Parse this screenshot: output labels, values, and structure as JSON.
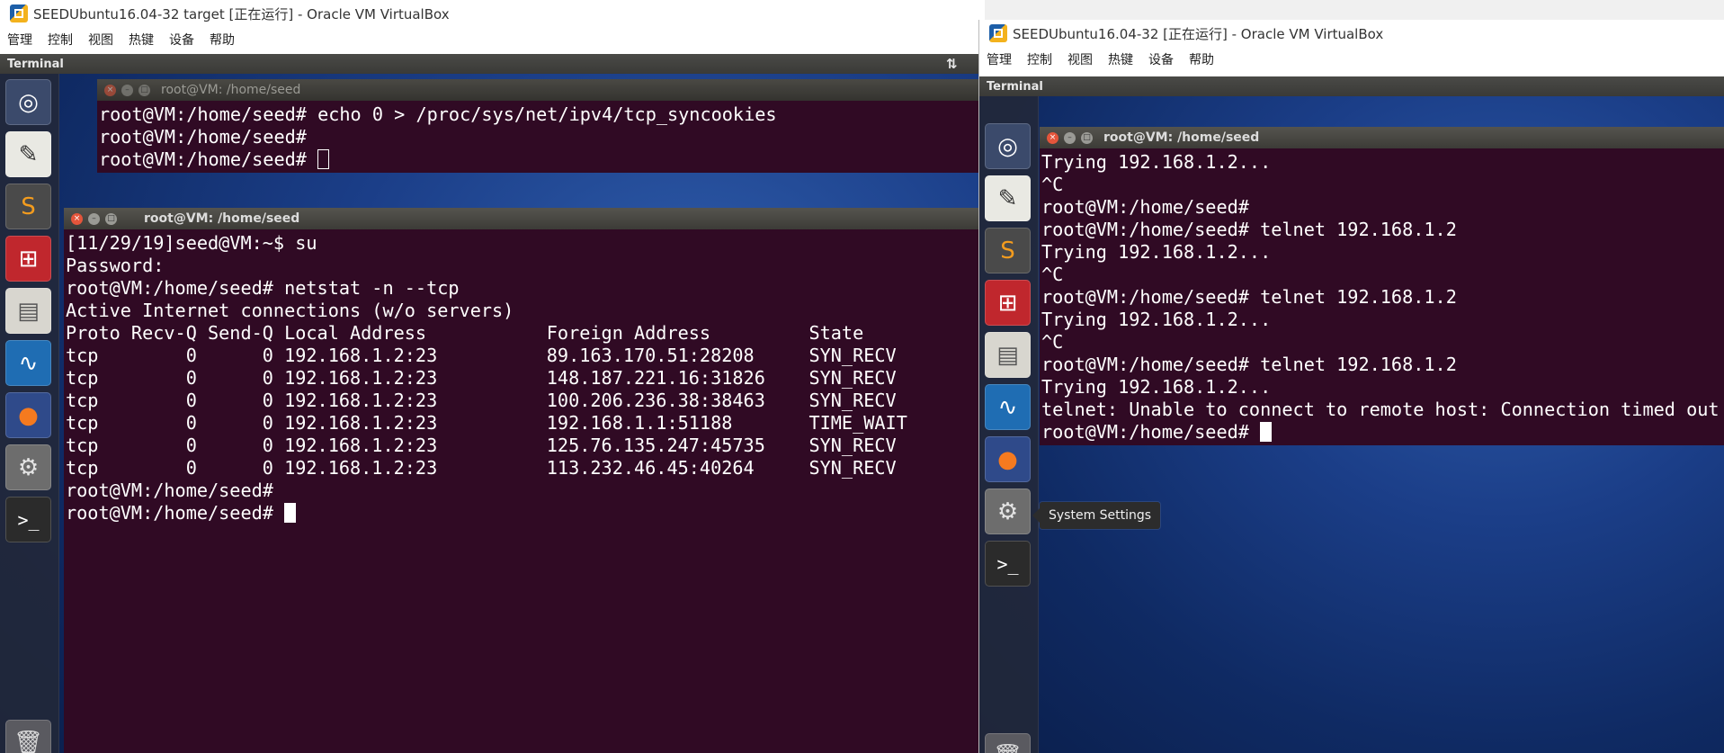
{
  "left_vm": {
    "title": "SEEDUbuntu16.04-32 target [正在运行] - Oracle VM VirtualBox",
    "menu": [
      "管理",
      "控制",
      "视图",
      "热键",
      "设备",
      "帮助"
    ],
    "window_controls": [
      "—",
      "☐",
      "✕"
    ],
    "unity_bar_title": "Terminal",
    "unity_bar_icon": "⇅",
    "terminal_top": {
      "title": "root@VM: /home/seed",
      "lines": [
        "root@VM:/home/seed# echo 0 > /proc/sys/net/ipv4/tcp_syncookies",
        "root@VM:/home/seed# ",
        "root@VM:/home/seed# "
      ]
    },
    "terminal_main": {
      "title": "root@VM: /home/seed",
      "lines": [
        "[11/29/19]seed@VM:~$ su",
        "Password:",
        "root@VM:/home/seed# netstat -n --tcp",
        "Active Internet connections (w/o servers)",
        "Proto Recv-Q Send-Q Local Address           Foreign Address         State",
        "tcp        0      0 192.168.1.2:23          89.163.170.51:28208     SYN_RECV",
        "tcp        0      0 192.168.1.2:23          148.187.221.16:31826    SYN_RECV",
        "tcp        0      0 192.168.1.2:23          100.206.236.38:38463    SYN_RECV",
        "tcp        0      0 192.168.1.2:23          192.168.1.1:51188       TIME_WAIT",
        "tcp        0      0 192.168.1.2:23          125.76.135.247:45735    SYN_RECV",
        "tcp        0      0 192.168.1.2:23          113.232.46.45:40264     SYN_RECV",
        "root@VM:/home/seed# ",
        "root@VM:/home/seed# "
      ]
    }
  },
  "right_vm": {
    "title": "SEEDUbuntu16.04-32 [正在运行] - Oracle VM VirtualBox",
    "menu": [
      "管理",
      "控制",
      "视图",
      "热键",
      "设备",
      "帮助"
    ],
    "unity_bar_title": "Terminal",
    "terminal": {
      "title": "root@VM: /home/seed",
      "lines": [
        "Trying 192.168.1.2...",
        "^C",
        "root@VM:/home/seed# ",
        "root@VM:/home/seed# telnet 192.168.1.2",
        "Trying 192.168.1.2...",
        "^C",
        "root@VM:/home/seed# telnet 192.168.1.2",
        "Trying 192.168.1.2...",
        "^C",
        "root@VM:/home/seed# telnet 192.168.1.2",
        "Trying 192.168.1.2...",
        "telnet: Unable to connect to remote host: Connection timed out",
        "root@VM:/home/seed# "
      ]
    },
    "tooltip": "System Settings"
  },
  "launcher_icons": [
    {
      "name": "ubuntu-dash-icon",
      "glyph": "◎",
      "bg": "#3b4a6b",
      "fg": "#ffffff"
    },
    {
      "name": "text-editor-icon",
      "glyph": "✎",
      "bg": "#e9e9e3",
      "fg": "#333333"
    },
    {
      "name": "sublime-text-icon",
      "glyph": "S",
      "bg": "#4a4a4a",
      "fg": "#f39c1e"
    },
    {
      "name": "network-tool-icon",
      "glyph": "⊞",
      "bg": "#c0272d",
      "fg": "#ffffff"
    },
    {
      "name": "file-manager-icon",
      "glyph": "▤",
      "bg": "#d8d6cf",
      "fg": "#555555"
    },
    {
      "name": "wireshark-icon",
      "glyph": "∿",
      "bg": "#1f6db3",
      "fg": "#ffffff"
    },
    {
      "name": "firefox-icon",
      "glyph": "●",
      "bg": "#2f4a8a",
      "fg": "#f57a1f"
    },
    {
      "name": "system-settings-icon",
      "glyph": "⚙",
      "bg": "#6d6d6d",
      "fg": "#e4e4e4"
    },
    {
      "name": "terminal-icon",
      "glyph": ">_",
      "bg": "#2b2b2b",
      "fg": "#ffffff"
    }
  ],
  "trash_icon": {
    "name": "trash-icon",
    "glyph": "🗑"
  },
  "colors": {
    "terminal_bg": "#300a24",
    "terminal_fg": "#ffffff",
    "close_btn": "#e4553b"
  }
}
